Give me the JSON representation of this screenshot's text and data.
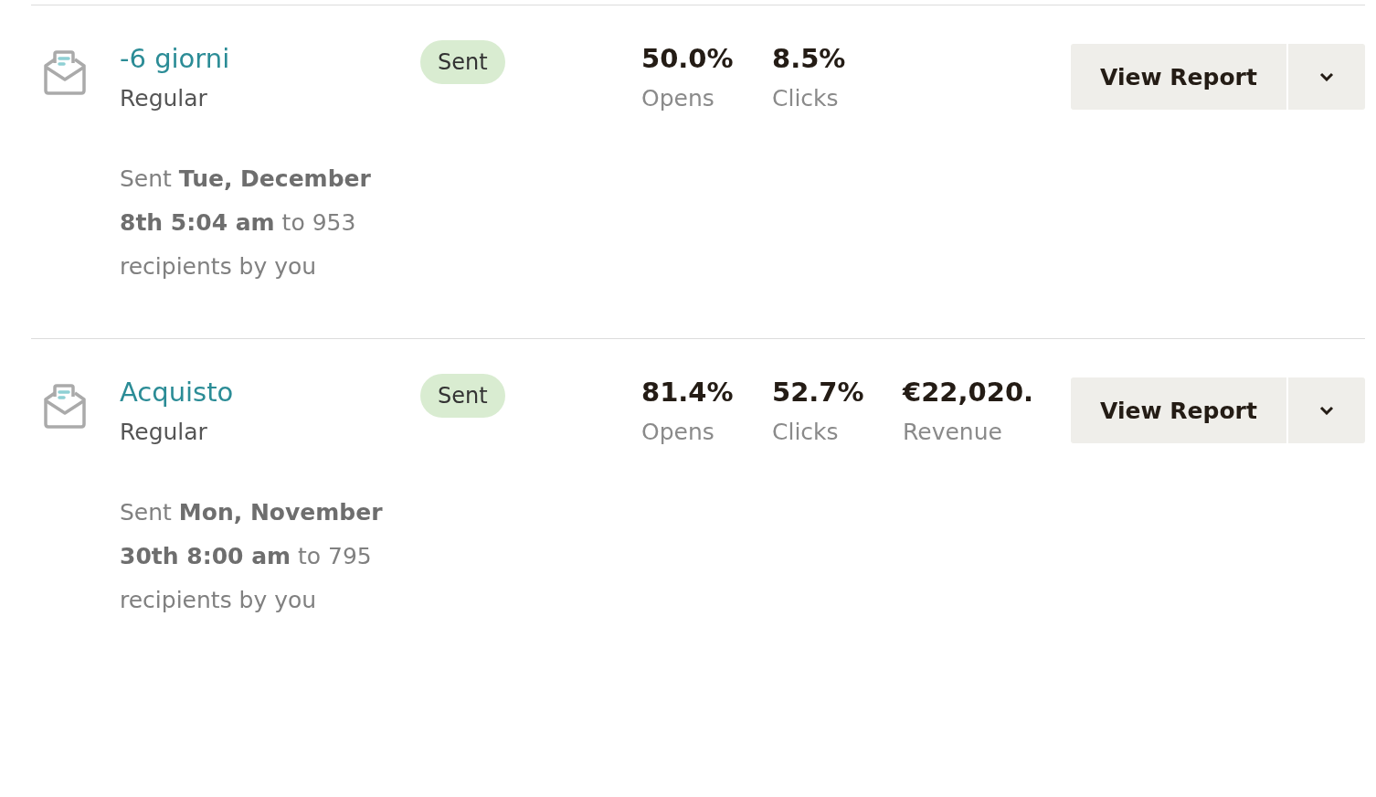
{
  "campaigns": [
    {
      "name": "-6 giorni",
      "type": "Regular",
      "status": "Sent",
      "sent_info": "Sent **Tue, December 8th 5:04 am** to 953 recipients by you",
      "stats": [
        {
          "value": "50.0%",
          "label": "Opens"
        },
        {
          "value": "8.5%",
          "label": "Clicks"
        }
      ],
      "button": "View Report"
    },
    {
      "name": "Acquisto",
      "type": "Regular",
      "status": "Sent",
      "sent_info": "Sent **Mon, November 30th 8:00 am** to 795 recipients by you",
      "stats": [
        {
          "value": "81.4%",
          "label": "Opens"
        },
        {
          "value": "52.7%",
          "label": "Clicks"
        },
        {
          "value": "€22,020.",
          "label": "Revenue"
        }
      ],
      "button": "View Report"
    }
  ]
}
